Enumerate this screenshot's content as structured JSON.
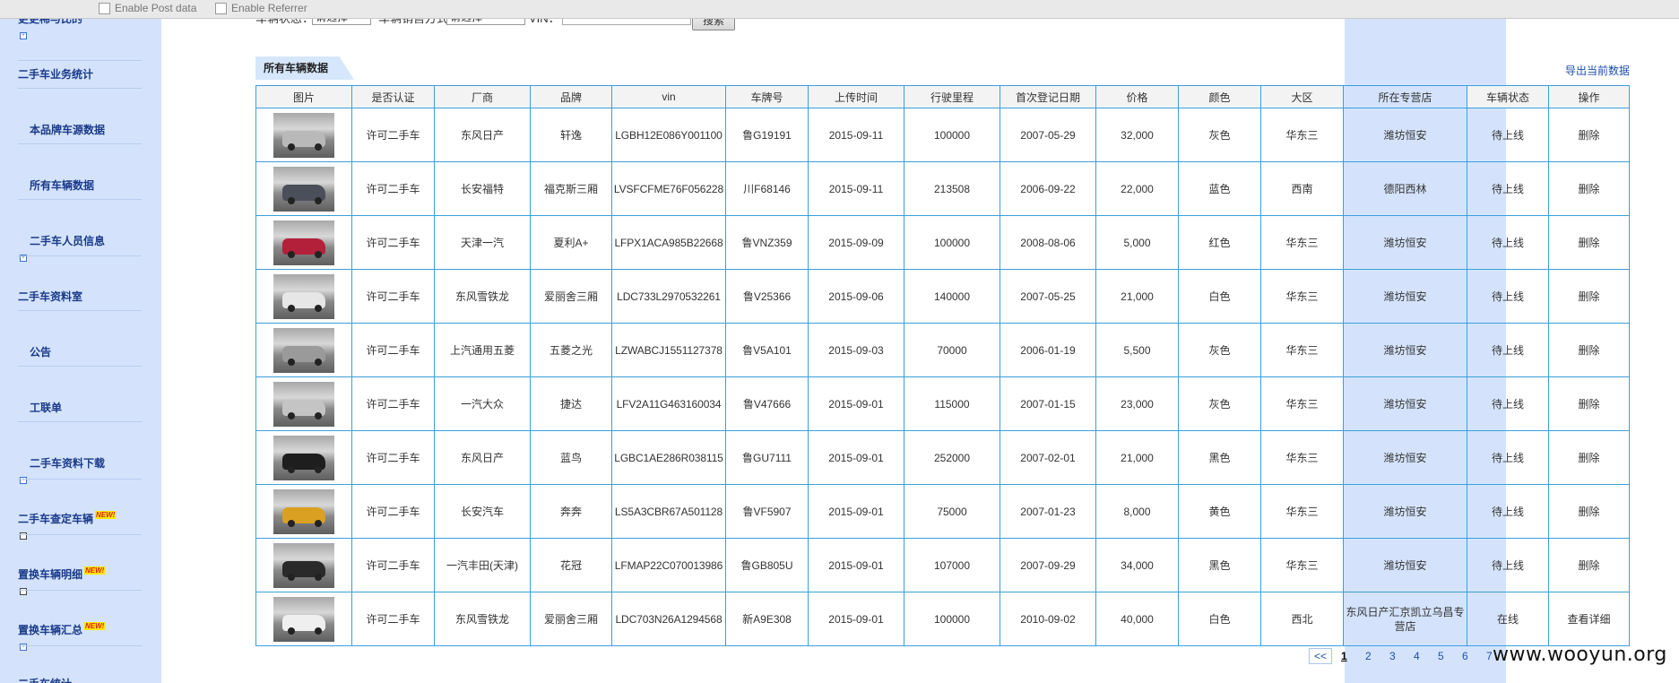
{
  "toolbar": {
    "post_data_label": "Enable Post data",
    "referrer_label": "Enable Referrer"
  },
  "sidebar": {
    "top_cut_label": "更更稀与比的",
    "items": [
      {
        "label": "二手车业务统计"
      },
      {
        "label": "本品牌车源数据"
      },
      {
        "label": "所有车辆数据"
      },
      {
        "label": "二手车人员信息"
      },
      {
        "label": "二手车资料室"
      },
      {
        "label": "公告"
      },
      {
        "label": "工联单"
      },
      {
        "label": "二手车资料下载"
      },
      {
        "label": "二手车查定车辆"
      },
      {
        "label": "置换车辆明细"
      },
      {
        "label": "置换车辆汇总"
      },
      {
        "label": "二手车统计"
      }
    ],
    "new_badge": "NEW!"
  },
  "filters": {
    "status_label": "车辆状态：",
    "status_value": "请选择",
    "sale_label": "车辆销售方式",
    "sale_value": "请选择",
    "vin_label": "VIN：",
    "search_button": "搜索"
  },
  "tab_label": "所有车辆数据",
  "export_label": "导出当前数据",
  "columns": [
    "图片",
    "是否认证",
    "厂商",
    "品牌",
    "vin",
    "车牌号",
    "上传时间",
    "行驶里程",
    "首次登记日期",
    "价格",
    "颜色",
    "大区",
    "所在专营店",
    "车辆状态",
    "操作"
  ],
  "rows": [
    {
      "cert": "许可二手车",
      "maker": "东风日产",
      "brand": "轩逸",
      "vin": "LGBH12E086Y001100",
      "plate": "鲁G19191",
      "upload": "2015-09-11",
      "mileage": "100000",
      "regdate": "2007-05-29",
      "price": "32,000",
      "color": "灰色",
      "region": "华东三",
      "dealer": "潍坊恒安",
      "status": "待上线",
      "action": "删除",
      "car_color": "#b9b9b9"
    },
    {
      "cert": "许可二手车",
      "maker": "长安福特",
      "brand": "福克斯三厢",
      "vin": "LVSFCFME76F056228",
      "plate": "川F68146",
      "upload": "2015-09-11",
      "mileage": "213508",
      "regdate": "2006-09-22",
      "price": "22,000",
      "color": "蓝色",
      "region": "西南",
      "dealer": "德阳西林",
      "status": "待上线",
      "action": "删除",
      "car_color": "#4a4f5a"
    },
    {
      "cert": "许可二手车",
      "maker": "天津一汽",
      "brand": "夏利A+",
      "vin": "LFPX1ACA985B22668",
      "plate": "鲁VNZ359",
      "upload": "2015-09-09",
      "mileage": "100000",
      "regdate": "2008-08-06",
      "price": "5,000",
      "color": "红色",
      "region": "华东三",
      "dealer": "潍坊恒安",
      "status": "待上线",
      "action": "删除",
      "car_color": "#b3203a"
    },
    {
      "cert": "许可二手车",
      "maker": "东风雪铁龙",
      "brand": "爱丽舍三厢",
      "vin": "LDC733L2970532261",
      "plate": "鲁V25366",
      "upload": "2015-09-06",
      "mileage": "140000",
      "regdate": "2007-05-25",
      "price": "21,000",
      "color": "白色",
      "region": "华东三",
      "dealer": "潍坊恒安",
      "status": "待上线",
      "action": "删除",
      "car_color": "#e6e6e6"
    },
    {
      "cert": "许可二手车",
      "maker": "上汽通用五菱",
      "brand": "五菱之光",
      "vin": "LZWABCJ1551127378",
      "plate": "鲁V5A101",
      "upload": "2015-09-03",
      "mileage": "70000",
      "regdate": "2006-01-19",
      "price": "5,500",
      "color": "灰色",
      "region": "华东三",
      "dealer": "潍坊恒安",
      "status": "待上线",
      "action": "删除",
      "car_color": "#9a9a9a"
    },
    {
      "cert": "许可二手车",
      "maker": "一汽大众",
      "brand": "捷达",
      "vin": "LFV2A11G463160034",
      "plate": "鲁V47666",
      "upload": "2015-09-01",
      "mileage": "115000",
      "regdate": "2007-01-15",
      "price": "23,000",
      "color": "灰色",
      "region": "华东三",
      "dealer": "潍坊恒安",
      "status": "待上线",
      "action": "删除",
      "car_color": "#c4c4c4"
    },
    {
      "cert": "许可二手车",
      "maker": "东风日产",
      "brand": "蓝鸟",
      "vin": "LGBC1AE286R038115",
      "plate": "鲁GU7111",
      "upload": "2015-09-01",
      "mileage": "252000",
      "regdate": "2007-02-01",
      "price": "21,000",
      "color": "黑色",
      "region": "华东三",
      "dealer": "潍坊恒安",
      "status": "待上线",
      "action": "删除",
      "car_color": "#1e1e1e"
    },
    {
      "cert": "许可二手车",
      "maker": "长安汽车",
      "brand": "奔奔",
      "vin": "LS5A3CBR67A501128",
      "plate": "鲁VF5907",
      "upload": "2015-09-01",
      "mileage": "75000",
      "regdate": "2007-01-23",
      "price": "8,000",
      "color": "黄色",
      "region": "华东三",
      "dealer": "潍坊恒安",
      "status": "待上线",
      "action": "删除",
      "car_color": "#d9a021"
    },
    {
      "cert": "许可二手车",
      "maker": "一汽丰田(天津)",
      "brand": "花冠",
      "vin": "LFMAP22C070013986",
      "plate": "鲁GB805U",
      "upload": "2015-09-01",
      "mileage": "107000",
      "regdate": "2007-09-29",
      "price": "34,000",
      "color": "黑色",
      "region": "华东三",
      "dealer": "潍坊恒安",
      "status": "待上线",
      "action": "删除",
      "car_color": "#2a2a2a"
    },
    {
      "cert": "许可二手车",
      "maker": "东风雪铁龙",
      "brand": "爱丽舍三厢",
      "vin": "LDC703N26A1294568",
      "plate": "新A9E308",
      "upload": "2015-09-01",
      "mileage": "100000",
      "regdate": "2010-09-02",
      "price": "40,000",
      "color": "白色",
      "region": "西北",
      "dealer": "东风日产汇京凯立乌昌专营店",
      "status": "在线",
      "action": "查看详细",
      "car_color": "#efefef"
    }
  ],
  "pagination": {
    "prev": "<<",
    "pages": [
      "1",
      "2",
      "3",
      "4",
      "5",
      "6",
      "7"
    ],
    "current": "1"
  },
  "watermark": "www.wooyun.org"
}
